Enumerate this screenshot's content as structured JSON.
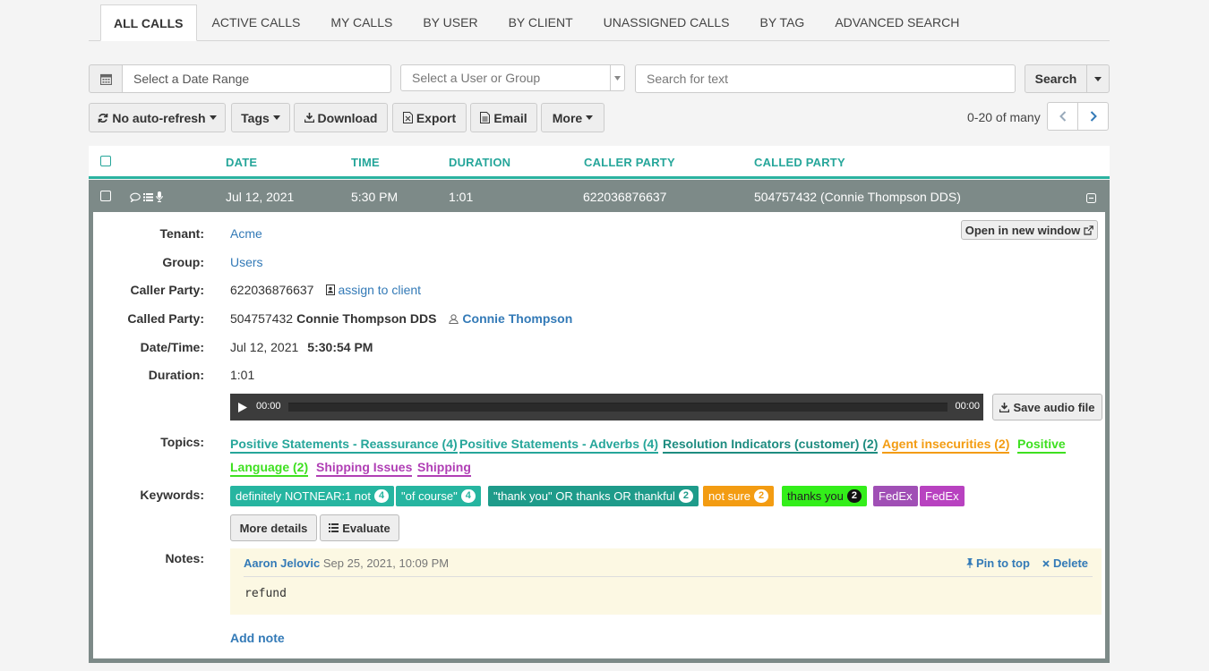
{
  "tabs": [
    "ALL CALLS",
    "ACTIVE CALLS",
    "MY CALLS",
    "BY USER",
    "BY CLIENT",
    "UNASSIGNED CALLS",
    "BY TAG",
    "ADVANCED SEARCH"
  ],
  "filters": {
    "date_placeholder": "Select a Date Range",
    "user_placeholder": "Select a User or Group",
    "text_placeholder": "Search for text",
    "search_label": "Search"
  },
  "toolbar": {
    "refresh_label": "No auto-refresh",
    "tags_label": "Tags",
    "download_label": "Download",
    "export_label": "Export",
    "email_label": "Email",
    "more_label": "More",
    "pager_text": "0-20 of many"
  },
  "table": {
    "headers": [
      "DATE",
      "TIME",
      "DURATION",
      "CALLER PARTY",
      "CALLED PARTY"
    ],
    "row": {
      "date": "Jul 12, 2021",
      "time": "5:30 PM",
      "duration": "1:01",
      "caller": "622036876637",
      "called": "504757432 (Connie Thompson DDS)"
    }
  },
  "detail": {
    "open_window_label": "Open in new window",
    "tenant_label": "Tenant:",
    "tenant": "Acme",
    "group_label": "Group:",
    "group": "Users",
    "caller_label": "Caller Party:",
    "caller_number": "622036876637",
    "assign_label": "assign to client",
    "called_label": "Called Party:",
    "called_number": "504757432",
    "called_name": "Connie Thompson DDS",
    "called_contact": "Connie Thompson",
    "datetime_label": "Date/Time:",
    "date": "Jul 12, 2021",
    "time": "5:30:54 PM",
    "duration_label": "Duration:",
    "duration": "1:01",
    "player_start": "00:00",
    "player_end": "00:00",
    "save_audio_label": "Save audio file",
    "topics_label": "Topics:",
    "topics": [
      {
        "text": "Positive Statements - Reassurance (4)",
        "color": "#26a69a"
      },
      {
        "text": "Positive Statements - Adverbs (4)",
        "color": "#26a69a"
      },
      {
        "text": "Resolution Indicators (customer) (2)",
        "color": "#1e8c80"
      },
      {
        "text": "Agent insecurities (2)",
        "color": "#f39c12"
      },
      {
        "text": "Positive",
        "color": "#3ee020"
      },
      {
        "text": "Language (2)",
        "color": "#3ee020"
      },
      {
        "text": "Shipping Issues",
        "color": "#b03fb5"
      },
      {
        "text": "Shipping",
        "color": "#b03fb5"
      }
    ],
    "keywords_label": "Keywords:",
    "keywords": [
      {
        "text": "definitely NOTNEAR:1 not",
        "count": "4",
        "color": "#26b5a0"
      },
      {
        "text": "\"of course\"",
        "count": "4",
        "color": "#26b5a0"
      },
      {
        "text": "\"thank you\" OR thanks OR thankful",
        "count": "2",
        "color": "#1e9b8a"
      },
      {
        "text": "not sure",
        "count": "2",
        "color": "#f39c12"
      },
      {
        "text": "thanks you",
        "count": "2",
        "color": "#33ee1a"
      },
      {
        "text": "FedEx",
        "count": "",
        "color": "#a04fb5"
      },
      {
        "text": "FedEx",
        "count": "",
        "color": "#b842c0"
      }
    ],
    "more_details_label": "More details",
    "evaluate_label": "Evaluate",
    "notes_label": "Notes:",
    "note": {
      "author": "Aaron Jelovic",
      "date": "Sep 25, 2021, 10:09 PM",
      "pin_label": "Pin to top",
      "delete_label": "Delete",
      "body": "refund"
    },
    "add_note_label": "Add note"
  }
}
